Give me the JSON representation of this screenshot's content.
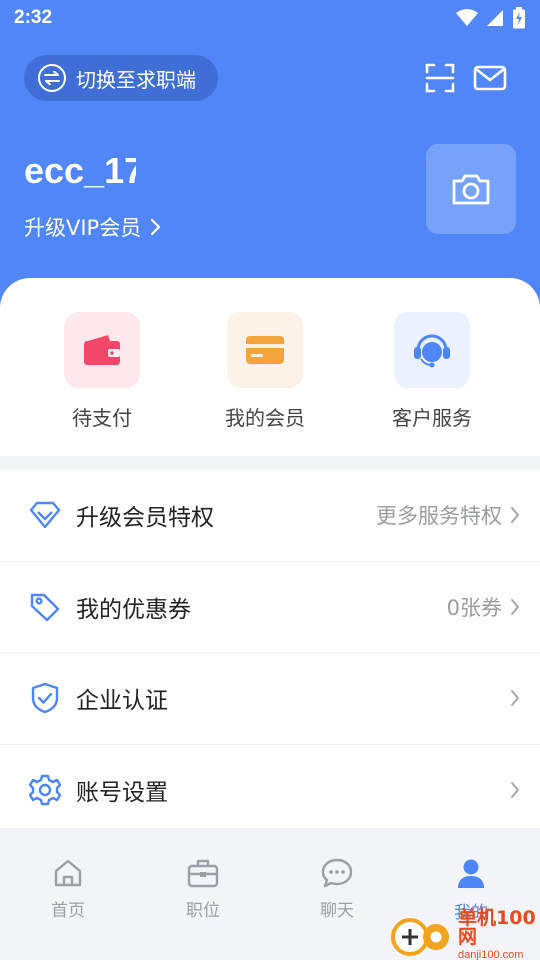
{
  "status_bar": {
    "time": "2:32"
  },
  "header": {
    "switch_label": "切换至求职端",
    "username": "ecc_17",
    "vip_label": "升级VIP会员",
    "icons": {
      "scan": "scan-icon",
      "mail": "mail-icon",
      "camera": "camera-icon"
    }
  },
  "quick_actions": [
    {
      "label": "待支付",
      "icon": "wallet-icon",
      "bg": "#fde9ec",
      "color": "#f1486a"
    },
    {
      "label": "我的会员",
      "icon": "member-card-icon",
      "bg": "#fdf2e7",
      "color": "#f3a43b"
    },
    {
      "label": "客户服务",
      "icon": "customer-service-icon",
      "bg": "#ebf1fe",
      "color": "#4f86f7"
    }
  ],
  "menu": [
    {
      "title": "升级会员特权",
      "value": "更多服务特权",
      "icon": "diamond-icon"
    },
    {
      "title": "我的优惠券",
      "value": "0张券",
      "icon": "coupon-tag-icon"
    },
    {
      "title": "企业认证",
      "value": "",
      "icon": "shield-check-icon"
    },
    {
      "title": "账号设置",
      "value": "",
      "icon": "gear-icon"
    }
  ],
  "tabs": [
    {
      "label": "首页",
      "icon": "home-icon",
      "active": false
    },
    {
      "label": "职位",
      "icon": "briefcase-icon",
      "active": false
    },
    {
      "label": "聊天",
      "icon": "chat-icon",
      "active": false
    },
    {
      "label": "我的",
      "icon": "user-icon",
      "active": true
    }
  ],
  "watermark": {
    "cn": "单机100网",
    "en": "danji100.com"
  },
  "colors": {
    "primary": "#5086f7",
    "accent_blue": "#4f86f7",
    "wallet": "#f1486a",
    "card": "#f3a43b",
    "watermark": "#e84b1f"
  }
}
